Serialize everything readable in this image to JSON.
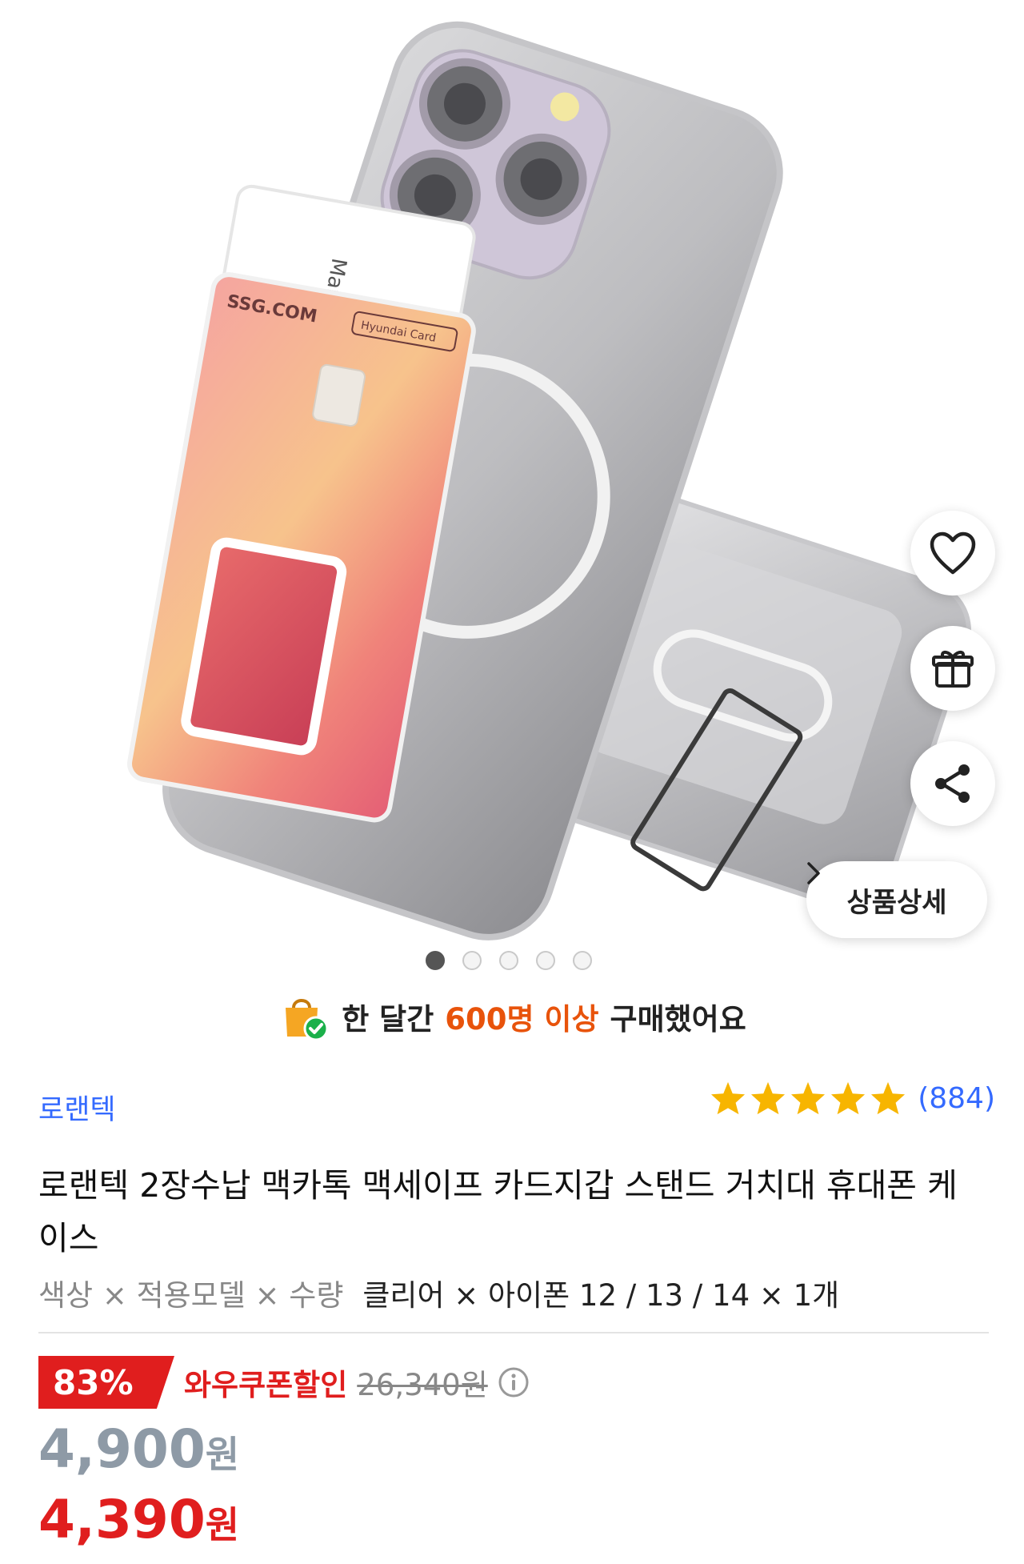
{
  "carousel": {
    "product_image_alt": "product-photo",
    "card_name_text": "Marisa",
    "card_brand_text": "SSG.COM",
    "card_issuer_text": "Hyundai Card",
    "dots_count": 5,
    "active_dot_index": 0,
    "detail_button_label": "상품상세"
  },
  "banner": {
    "prefix": "한 달간",
    "highlight": "600명 이상",
    "suffix": "구매했어요"
  },
  "product": {
    "brand": "로랜텍",
    "rating_stars": 5,
    "review_count": "(884)",
    "title": "로랜텍 2장수납 맥카톡 맥세이프 카드지갑 스탠드 거치대 휴대폰 케이스",
    "options_label": "색상 × 적용모델 × 수량",
    "options_value": "클리어 × 아이폰 12 / 13 / 14 × 1개"
  },
  "price": {
    "discount_rate": "83%",
    "coupon_label": "와우쿠폰할인",
    "original_price": "26,340원",
    "sale_price_number": "4,900",
    "sale_price_unit": "원",
    "coupon_price_number": "4,390",
    "coupon_price_unit": "원"
  },
  "colors": {
    "accent_blue": "#346aff",
    "accent_red": "#e01e1e",
    "banner_orange": "#e8530b",
    "star_yellow": "#f7b500"
  }
}
